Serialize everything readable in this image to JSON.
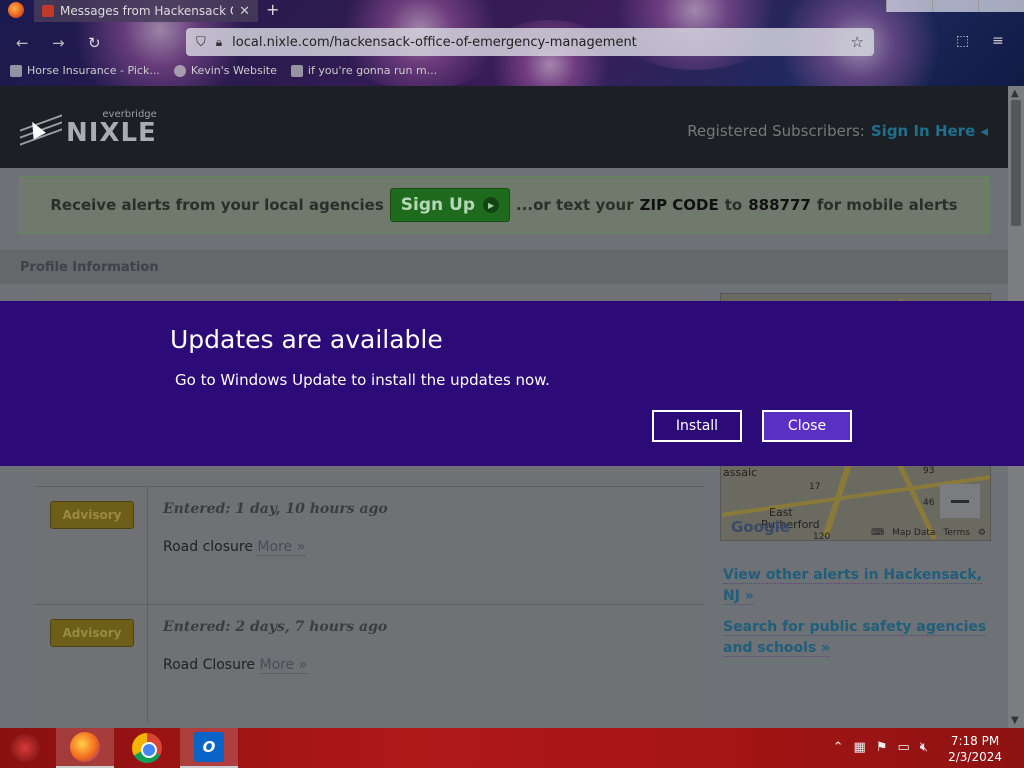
{
  "browser": {
    "tab_title": "Messages from Hackensack Off",
    "tab_close": "✕",
    "new_tab": "+",
    "url": "local.nixle.com/hackensack-office-of-emergency-management",
    "bookmarks": [
      {
        "label": "Horse Insurance - Pick..."
      },
      {
        "label": "Kevin's Website"
      },
      {
        "label": "if you're gonna run m..."
      }
    ]
  },
  "header": {
    "logo_small": "everbridge",
    "logo_big": "NIXLE",
    "registered_label": "Registered Subscribers:",
    "sign_in_label": "Sign In Here ◂"
  },
  "signup": {
    "lead": "Receive alerts from your local agencies",
    "button_label": "Sign Up",
    "text_before_zip": "...or text your",
    "zip_label": "ZIP CODE",
    "to_label": "to",
    "number": "888777",
    "trail": "for mobile alerts"
  },
  "profile": {
    "title": "Profile Information"
  },
  "alerts": [
    {
      "badge": "Advisory",
      "entered": "Entered: 1 day, 10 hours ago",
      "text": "Road closure",
      "more": "More »"
    },
    {
      "badge": "Advisory",
      "entered": "Entered: 2 days, 7 hours ago",
      "text": "Road Closure",
      "more": "More »"
    }
  ],
  "map": {
    "labels": [
      "assaic",
      "East",
      "Rutherford",
      "17",
      "93",
      "46",
      "120"
    ],
    "google": "Google",
    "attribution": {
      "keyboard": "⌨",
      "map_data": "Map Data",
      "terms": "Terms",
      "gear": "⚙"
    }
  },
  "side_links": {
    "other_alerts": "View other alerts in Hackensack, NJ »",
    "search_agencies": "Search for public safety agencies and schools »"
  },
  "toast": {
    "title": "Updates are available",
    "message": "Go to Windows Update to install the updates now.",
    "install_label": "Install",
    "close_label": "Close"
  },
  "taskbar": {
    "outlook_letter": "O",
    "time": "7:18 PM",
    "date": "2/3/2024"
  },
  "colors": {
    "toast_bg": "#2c0a78",
    "signup_green": "#1e6b1e",
    "link_blue": "#1f5f7a",
    "taskbar_red": "#b01818"
  }
}
